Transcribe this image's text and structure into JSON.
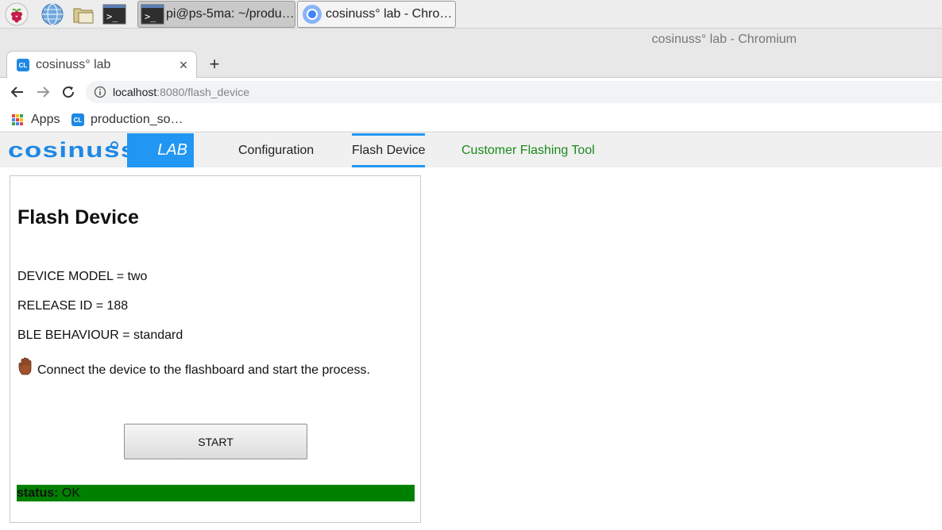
{
  "taskbar": {
    "launchers": [
      "raspberry-pi-menu-icon",
      "web-browser-icon",
      "file-manager-icon",
      "terminal-icon"
    ],
    "windows": [
      {
        "label": "pi@ps-5ma: ~/produ…",
        "icon": "terminal-icon",
        "active": true
      },
      {
        "label": "cosinuss° lab - Chro…",
        "icon": "chromium-icon",
        "active": false
      }
    ]
  },
  "browser": {
    "window_title": "cosinuss° lab - Chromium",
    "tab": {
      "title": "cosinuss° lab",
      "favicon_text": "CL",
      "close": "×"
    },
    "new_tab": "+",
    "url_host": "localhost",
    "url_rest": ":8080/flash_device",
    "bookmarks": [
      {
        "label": "Apps",
        "icon": "apps-grid-icon"
      },
      {
        "label": "production_so…",
        "icon": "cosinuss-favicon",
        "favicon_text": "CL"
      }
    ]
  },
  "site": {
    "logo_text": "cosinuss",
    "lab_label": "LAB",
    "nav": [
      {
        "label": "Configuration",
        "active": false
      },
      {
        "label": "Flash Device",
        "active": true
      },
      {
        "label": "Customer Flashing Tool",
        "active": false
      }
    ],
    "brand_color": "#2196f3",
    "link_green": "#1a8a1a"
  },
  "main": {
    "title": "Flash Device",
    "device_model": "DEVICE MODEL = two",
    "release_id": "RELEASE ID = 188",
    "ble_behaviour": "BLE BEHAVIOUR = standard",
    "instruction_icon": "raised-hand-icon",
    "instruction": "Connect the device to the flashboard and start the process.",
    "start_button": "START",
    "status_label": "status:",
    "status_value": "OK",
    "status_color": "#008000"
  }
}
